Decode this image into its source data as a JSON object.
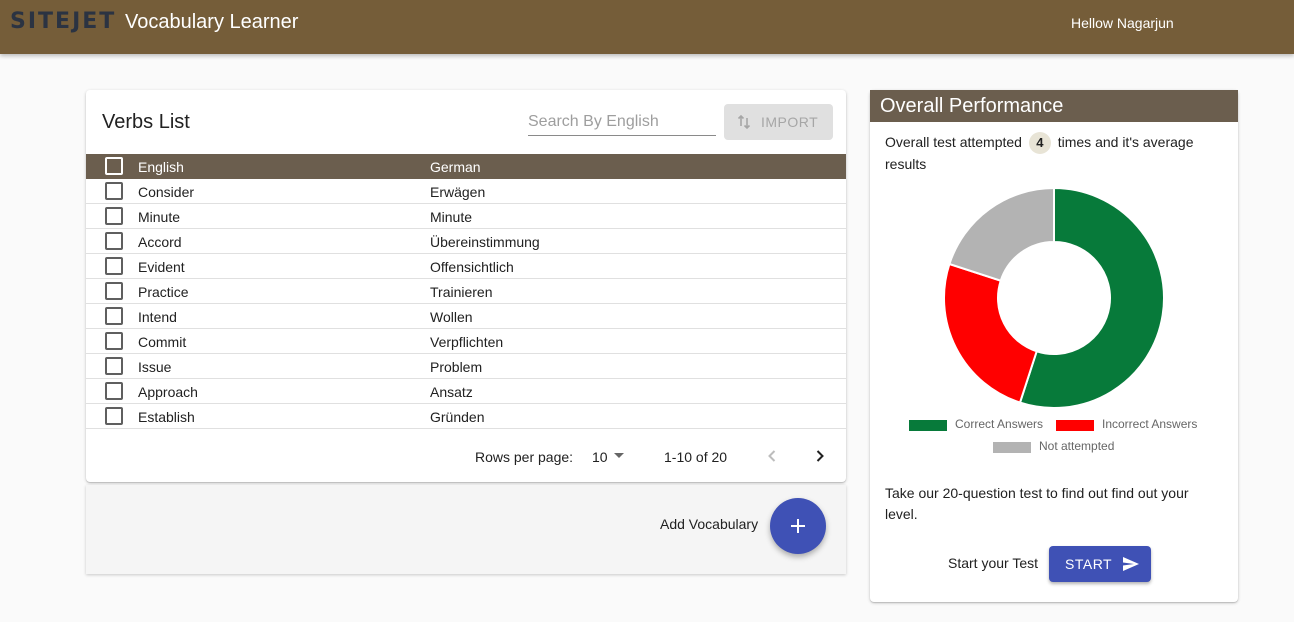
{
  "header": {
    "logo": "SITEJET",
    "title": "Vocabulary Learner",
    "greeting": "Hellow Nagarjun"
  },
  "verbs": {
    "title": "Verbs List",
    "search_placeholder": "Search By English",
    "import_label": "IMPORT",
    "columns": {
      "english": "English",
      "german": "German"
    },
    "rows": [
      {
        "english": "Consider",
        "german": "Erwägen"
      },
      {
        "english": "Minute",
        "german": "Minute"
      },
      {
        "english": "Accord",
        "german": "Übereinstimmung"
      },
      {
        "english": "Evident",
        "german": "Offensichtlich"
      },
      {
        "english": "Practice",
        "german": "Trainieren"
      },
      {
        "english": "Intend",
        "german": "Wollen"
      },
      {
        "english": "Commit",
        "german": "Verpflichten"
      },
      {
        "english": "Issue",
        "german": "Problem"
      },
      {
        "english": "Approach",
        "german": "Ansatz"
      },
      {
        "english": "Establish",
        "german": "Gründen"
      }
    ],
    "pagination": {
      "rows_per_page_label": "Rows per page:",
      "rows_per_page": "10",
      "range": "1-10 of 20"
    },
    "add_label": "Add Vocabulary"
  },
  "performance": {
    "title": "Overall Performance",
    "attempt_prefix": "Overall test attempted",
    "attempt_count": "4",
    "attempt_suffix": "times and it's average results",
    "legend": [
      {
        "label": "Correct Answers",
        "color": "#077a3a"
      },
      {
        "label": "Incorrect Answers",
        "color": "#ff0000"
      },
      {
        "label": "Not attempted",
        "color": "#b3b3b3"
      }
    ],
    "chart": {
      "type": "doughnut",
      "values": [
        55,
        25,
        20
      ]
    },
    "take_test": "Take our 20-question test to find out find out your level.",
    "start_prompt": "Start your Test",
    "start_label": "START"
  }
}
